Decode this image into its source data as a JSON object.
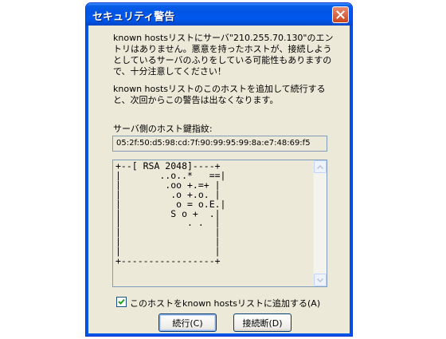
{
  "window": {
    "title": "セキュリティ警告"
  },
  "message": {
    "warning": "known hostsリストにサーバ\"210.255.70.130\"のエントリはありません。悪意を持ったホストが、接続しようとしているサーバのふりをしている可能性もありますので、十分注意してください！",
    "info": "known hostsリストのこのホストを追加して続行すると、次回からこの警告は出なくなります。"
  },
  "fingerprint": {
    "label": "サーバ側のホスト鍵指紋:",
    "value": "05:2f:50:d5:98:cd:7f:90:99:95:99:8a:e7:48:69:f5"
  },
  "randomart": "+--[ RSA 2048]----+\n|       ..o..*   ==|\n|        .oo +.=+ |\n|         .o +.o. |\n|          o = o.E.|\n|         S o +  .|\n|            . .  |\n|                 |\n|                 |\n|                 |\n+-----------------+",
  "checkbox": {
    "label": "このホストをknown hostsリストに追加する(A)",
    "checked": true
  },
  "buttons": {
    "continue": "続行(C)",
    "disconnect": "接続断(D)"
  },
  "colors": {
    "titlebar": "#0055e5",
    "dialog_bg": "#ece9d8",
    "close_button": "#c9461f"
  }
}
